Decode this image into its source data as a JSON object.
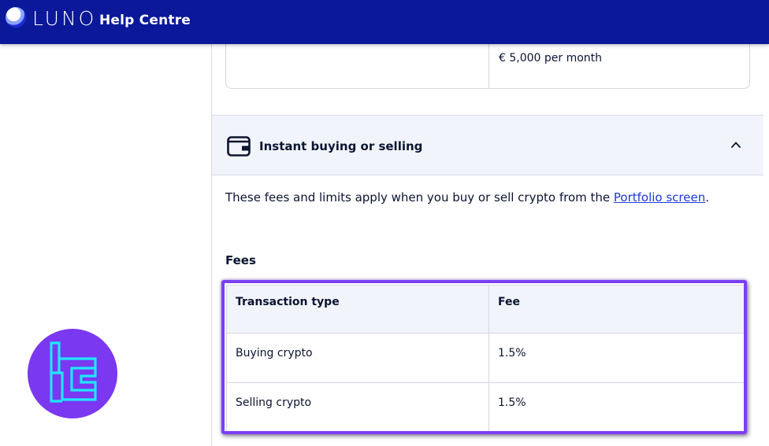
{
  "header": {
    "logo_text": "LUNO",
    "title": "Help Centre"
  },
  "previous_table": {
    "visible_cell": "€ 5,000 per month"
  },
  "accordion": {
    "title": "Instant buying or selling",
    "icon": "wallet-icon",
    "state_icon": "chevron-up-icon"
  },
  "content": {
    "intro_before_link": "These fees and limits apply when you buy or sell crypto from the ",
    "intro_link": "Portfolio screen",
    "intro_after_link": ".",
    "fees_heading": "Fees"
  },
  "fee_table": {
    "columns": [
      "Transaction type",
      "Fee"
    ],
    "rows": [
      [
        "Buying crypto",
        "1.5%"
      ],
      [
        "Selling crypto",
        "1.5%"
      ]
    ]
  },
  "colors": {
    "topbar": "#0a1899",
    "highlight": "#7b3ff2",
    "badge": "#7a38f0",
    "link": "#1a3ad6"
  }
}
